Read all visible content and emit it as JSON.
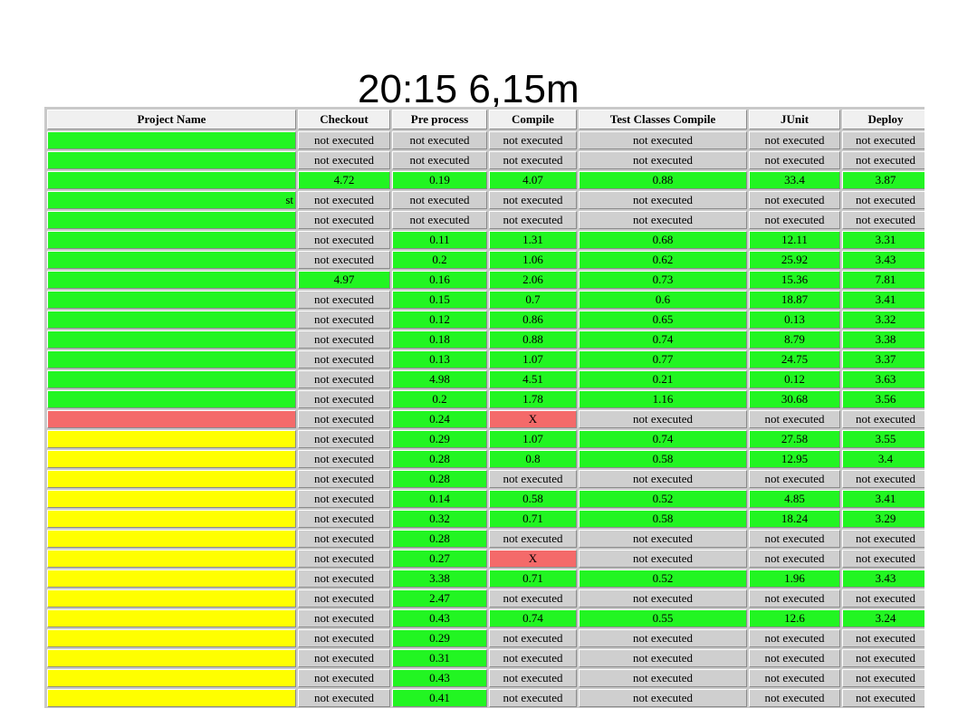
{
  "slide": {
    "title": "20:15 6,15m"
  },
  "colors": {
    "green": "#22f522",
    "grey": "#cfcfcf",
    "red": "#f46a6a",
    "yellow": "#ffff00"
  },
  "table": {
    "headers": [
      "Project Name",
      "Checkout",
      "Pre process",
      "Compile",
      "Test Classes Compile",
      "JUnit",
      "Deploy"
    ],
    "rows": [
      {
        "name": "",
        "name_color": "green",
        "cells": [
          [
            "not executed",
            "grey"
          ],
          [
            "not executed",
            "grey"
          ],
          [
            "not executed",
            "grey"
          ],
          [
            "not executed",
            "grey"
          ],
          [
            "not executed",
            "grey"
          ],
          [
            "not executed",
            "grey"
          ]
        ]
      },
      {
        "name": "",
        "name_color": "green",
        "cells": [
          [
            "not executed",
            "grey"
          ],
          [
            "not executed",
            "grey"
          ],
          [
            "not executed",
            "grey"
          ],
          [
            "not executed",
            "grey"
          ],
          [
            "not executed",
            "grey"
          ],
          [
            "not executed",
            "grey"
          ]
        ]
      },
      {
        "name": "",
        "name_color": "green",
        "cells": [
          [
            "4.72",
            "green"
          ],
          [
            "0.19",
            "green"
          ],
          [
            "4.07",
            "green"
          ],
          [
            "0.88",
            "green"
          ],
          [
            "33.4",
            "green"
          ],
          [
            "3.87",
            "green"
          ]
        ]
      },
      {
        "name": "st",
        "name_color": "green",
        "cells": [
          [
            "not executed",
            "grey"
          ],
          [
            "not executed",
            "grey"
          ],
          [
            "not executed",
            "grey"
          ],
          [
            "not executed",
            "grey"
          ],
          [
            "not executed",
            "grey"
          ],
          [
            "not executed",
            "grey"
          ]
        ]
      },
      {
        "name": "",
        "name_color": "green",
        "cells": [
          [
            "not executed",
            "grey"
          ],
          [
            "not executed",
            "grey"
          ],
          [
            "not executed",
            "grey"
          ],
          [
            "not executed",
            "grey"
          ],
          [
            "not executed",
            "grey"
          ],
          [
            "not executed",
            "grey"
          ]
        ]
      },
      {
        "name": "",
        "name_color": "green",
        "cells": [
          [
            "not executed",
            "grey"
          ],
          [
            "0.11",
            "green"
          ],
          [
            "1.31",
            "green"
          ],
          [
            "0.68",
            "green"
          ],
          [
            "12.11",
            "green"
          ],
          [
            "3.31",
            "green"
          ]
        ]
      },
      {
        "name": "",
        "name_color": "green",
        "cells": [
          [
            "not executed",
            "grey"
          ],
          [
            "0.2",
            "green"
          ],
          [
            "1.06",
            "green"
          ],
          [
            "0.62",
            "green"
          ],
          [
            "25.92",
            "green"
          ],
          [
            "3.43",
            "green"
          ]
        ]
      },
      {
        "name": "",
        "name_color": "green",
        "cells": [
          [
            "4.97",
            "green"
          ],
          [
            "0.16",
            "green"
          ],
          [
            "2.06",
            "green"
          ],
          [
            "0.73",
            "green"
          ],
          [
            "15.36",
            "green"
          ],
          [
            "7.81",
            "green"
          ]
        ]
      },
      {
        "name": "",
        "name_color": "green",
        "cells": [
          [
            "not executed",
            "grey"
          ],
          [
            "0.15",
            "green"
          ],
          [
            "0.7",
            "green"
          ],
          [
            "0.6",
            "green"
          ],
          [
            "18.87",
            "green"
          ],
          [
            "3.41",
            "green"
          ]
        ]
      },
      {
        "name": "",
        "name_color": "green",
        "cells": [
          [
            "not executed",
            "grey"
          ],
          [
            "0.12",
            "green"
          ],
          [
            "0.86",
            "green"
          ],
          [
            "0.65",
            "green"
          ],
          [
            "0.13",
            "green"
          ],
          [
            "3.32",
            "green"
          ]
        ]
      },
      {
        "name": "",
        "name_color": "green",
        "cells": [
          [
            "not executed",
            "grey"
          ],
          [
            "0.18",
            "green"
          ],
          [
            "0.88",
            "green"
          ],
          [
            "0.74",
            "green"
          ],
          [
            "8.79",
            "green"
          ],
          [
            "3.38",
            "green"
          ]
        ]
      },
      {
        "name": "",
        "name_color": "green",
        "cells": [
          [
            "not executed",
            "grey"
          ],
          [
            "0.13",
            "green"
          ],
          [
            "1.07",
            "green"
          ],
          [
            "0.77",
            "green"
          ],
          [
            "24.75",
            "green"
          ],
          [
            "3.37",
            "green"
          ]
        ]
      },
      {
        "name": "",
        "name_color": "green",
        "cells": [
          [
            "not executed",
            "grey"
          ],
          [
            "4.98",
            "green"
          ],
          [
            "4.51",
            "green"
          ],
          [
            "0.21",
            "green"
          ],
          [
            "0.12",
            "green"
          ],
          [
            "3.63",
            "green"
          ]
        ]
      },
      {
        "name": "",
        "name_color": "green",
        "cells": [
          [
            "not executed",
            "grey"
          ],
          [
            "0.2",
            "green"
          ],
          [
            "1.78",
            "green"
          ],
          [
            "1.16",
            "green"
          ],
          [
            "30.68",
            "green"
          ],
          [
            "3.56",
            "green"
          ]
        ]
      },
      {
        "name": "",
        "name_color": "red",
        "cells": [
          [
            "not executed",
            "grey"
          ],
          [
            "0.24",
            "green"
          ],
          [
            "X",
            "red"
          ],
          [
            "not executed",
            "grey"
          ],
          [
            "not executed",
            "grey"
          ],
          [
            "not executed",
            "grey"
          ]
        ]
      },
      {
        "name": "",
        "name_color": "yellow",
        "cells": [
          [
            "not executed",
            "grey"
          ],
          [
            "0.29",
            "green"
          ],
          [
            "1.07",
            "green"
          ],
          [
            "0.74",
            "green"
          ],
          [
            "27.58",
            "green"
          ],
          [
            "3.55",
            "green"
          ]
        ]
      },
      {
        "name": "",
        "name_color": "yellow",
        "cells": [
          [
            "not executed",
            "grey"
          ],
          [
            "0.28",
            "green"
          ],
          [
            "0.8",
            "green"
          ],
          [
            "0.58",
            "green"
          ],
          [
            "12.95",
            "green"
          ],
          [
            "3.4",
            "green"
          ]
        ]
      },
      {
        "name": "",
        "name_color": "yellow",
        "cells": [
          [
            "not executed",
            "grey"
          ],
          [
            "0.28",
            "green"
          ],
          [
            "not executed",
            "grey"
          ],
          [
            "not executed",
            "grey"
          ],
          [
            "not executed",
            "grey"
          ],
          [
            "not executed",
            "grey"
          ]
        ]
      },
      {
        "name": "",
        "name_color": "yellow",
        "cells": [
          [
            "not executed",
            "grey"
          ],
          [
            "0.14",
            "green"
          ],
          [
            "0.58",
            "green"
          ],
          [
            "0.52",
            "green"
          ],
          [
            "4.85",
            "green"
          ],
          [
            "3.41",
            "green"
          ]
        ]
      },
      {
        "name": "",
        "name_color": "yellow",
        "cells": [
          [
            "not executed",
            "grey"
          ],
          [
            "0.32",
            "green"
          ],
          [
            "0.71",
            "green"
          ],
          [
            "0.58",
            "green"
          ],
          [
            "18.24",
            "green"
          ],
          [
            "3.29",
            "green"
          ]
        ]
      },
      {
        "name": "",
        "name_color": "yellow",
        "cells": [
          [
            "not executed",
            "grey"
          ],
          [
            "0.28",
            "green"
          ],
          [
            "not executed",
            "grey"
          ],
          [
            "not executed",
            "grey"
          ],
          [
            "not executed",
            "grey"
          ],
          [
            "not executed",
            "grey"
          ]
        ]
      },
      {
        "name": "",
        "name_color": "yellow",
        "cells": [
          [
            "not executed",
            "grey"
          ],
          [
            "0.27",
            "green"
          ],
          [
            "X",
            "red"
          ],
          [
            "not executed",
            "grey"
          ],
          [
            "not executed",
            "grey"
          ],
          [
            "not executed",
            "grey"
          ]
        ]
      },
      {
        "name": "",
        "name_color": "yellow",
        "cells": [
          [
            "not executed",
            "grey"
          ],
          [
            "3.38",
            "green"
          ],
          [
            "0.71",
            "green"
          ],
          [
            "0.52",
            "green"
          ],
          [
            "1.96",
            "green"
          ],
          [
            "3.43",
            "green"
          ]
        ]
      },
      {
        "name": "",
        "name_color": "yellow",
        "cells": [
          [
            "not executed",
            "grey"
          ],
          [
            "2.47",
            "green"
          ],
          [
            "not executed",
            "grey"
          ],
          [
            "not executed",
            "grey"
          ],
          [
            "not executed",
            "grey"
          ],
          [
            "not executed",
            "grey"
          ]
        ]
      },
      {
        "name": "",
        "name_color": "yellow",
        "cells": [
          [
            "not executed",
            "grey"
          ],
          [
            "0.43",
            "green"
          ],
          [
            "0.74",
            "green"
          ],
          [
            "0.55",
            "green"
          ],
          [
            "12.6",
            "green"
          ],
          [
            "3.24",
            "green"
          ]
        ]
      },
      {
        "name": "",
        "name_color": "yellow",
        "cells": [
          [
            "not executed",
            "grey"
          ],
          [
            "0.29",
            "green"
          ],
          [
            "not executed",
            "grey"
          ],
          [
            "not executed",
            "grey"
          ],
          [
            "not executed",
            "grey"
          ],
          [
            "not executed",
            "grey"
          ]
        ]
      },
      {
        "name": "",
        "name_color": "yellow",
        "cells": [
          [
            "not executed",
            "grey"
          ],
          [
            "0.31",
            "green"
          ],
          [
            "not executed",
            "grey"
          ],
          [
            "not executed",
            "grey"
          ],
          [
            "not executed",
            "grey"
          ],
          [
            "not executed",
            "grey"
          ]
        ]
      },
      {
        "name": "",
        "name_color": "yellow",
        "cells": [
          [
            "not executed",
            "grey"
          ],
          [
            "0.43",
            "green"
          ],
          [
            "not executed",
            "grey"
          ],
          [
            "not executed",
            "grey"
          ],
          [
            "not executed",
            "grey"
          ],
          [
            "not executed",
            "grey"
          ]
        ]
      },
      {
        "name": "",
        "name_color": "yellow",
        "cells": [
          [
            "not executed",
            "grey"
          ],
          [
            "0.41",
            "green"
          ],
          [
            "not executed",
            "grey"
          ],
          [
            "not executed",
            "grey"
          ],
          [
            "not executed",
            "grey"
          ],
          [
            "not executed",
            "grey"
          ]
        ]
      }
    ]
  }
}
